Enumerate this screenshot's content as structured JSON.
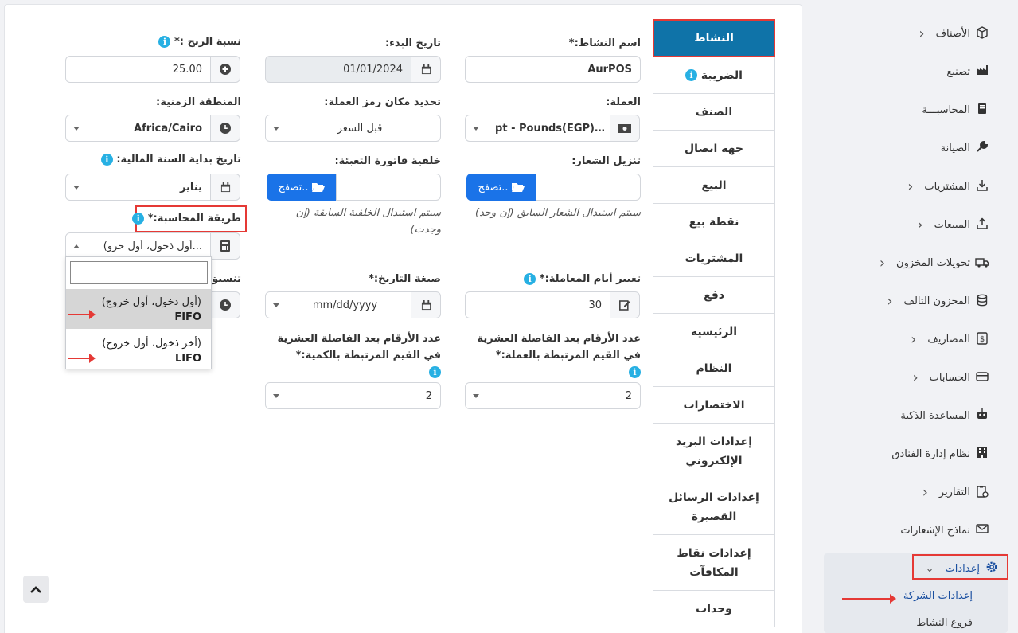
{
  "form": {
    "business_name_label": "اسم النشاط:*",
    "business_name_value": "AurPOS",
    "start_date_label": "تاريخ البدء:",
    "start_date_value": "01/01/2024",
    "profit_label": "نسبة الربح :*",
    "profit_value": "25.00",
    "currency_label": "العملة:",
    "currency_value": "pt - Pounds(EGP)",
    "currency_ellipsis": "…",
    "symbol_placement_label": "تحديد مكان رمز العملة:",
    "symbol_placement_value": "قبل السعر",
    "timezone_label": "المنطقة الزمنية:",
    "timezone_value": "Africa/Cairo",
    "logo_label": "تنزيل الشعار:",
    "logo_browse": "تصفح..",
    "logo_hint": "سيتم استبدال الشعار السابق (إن وجد)",
    "invoice_bg_label": "خلفية فاتورة التعبئة:",
    "invoice_bg_browse": "تصفح..",
    "invoice_bg_hint": "سيتم استبدال الخلفية السابقة (إن وجدت)",
    "fy_start_label": "تاريخ بداية السنة المالية:",
    "fy_start_value": "يناير",
    "accounting_method_label": "طريقة المحاسبة:*",
    "accounting_method_value": "(أول ذخول، أول خرو...",
    "transaction_days_label": "تغيير أيام المعاملة:*",
    "transaction_days_value": "30",
    "date_format_label": "صيغة التاريخ:*",
    "date_format_value": "mm/dd/yyyy",
    "time_format_label": "تنسيق",
    "currency_decimals_label": "عدد الأرقام بعد الفاصلة العشرية في القيم المرتبطة بالعملة:*",
    "currency_decimals_value": "2",
    "qty_decimals_label": "عدد الأرقام بعد الفاصلة العشرية في القيم المرتبطة بالكمية:*",
    "qty_decimals_value": "2",
    "info_glyph": "i"
  },
  "dropdown": {
    "options": [
      {
        "line1": "(أول ذخول، أول خروج)",
        "line2": "FIFO"
      },
      {
        "line1": "(أخر ذخول، أول خروج)",
        "line2": "LIFO"
      }
    ]
  },
  "tabs": [
    "النشاط",
    "الضريبة",
    "الصنف",
    "جهة اتصال",
    "البيع",
    "نقطة بيع",
    "المشتريات",
    "دفع",
    "الرئيسية",
    "النظام",
    "الاختصارات",
    "إعدادات البريد الإلكتروني",
    "إعدادات الرسائل القصيرة",
    "إعدادات نقاط المكافآت",
    "وحدات"
  ],
  "sidebar": {
    "items": [
      {
        "label": "الأصناف",
        "icon": "box-icon",
        "chevron": true
      },
      {
        "label": "تصنيع",
        "icon": "factory-icon",
        "chevron": false
      },
      {
        "label": "المحاسبـــة",
        "icon": "book-icon",
        "chevron": false
      },
      {
        "label": "الصيانة",
        "icon": "wrench-icon",
        "chevron": false
      },
      {
        "label": "المشتريات",
        "icon": "download-icon",
        "chevron": true
      },
      {
        "label": "المبيعات",
        "icon": "upload-icon",
        "chevron": true
      },
      {
        "label": "تحويلات المخزون",
        "icon": "truck-icon",
        "chevron": true
      },
      {
        "label": "المخزون التالف",
        "icon": "database-icon",
        "chevron": true
      },
      {
        "label": "المصاريف",
        "icon": "dollar-icon",
        "chevron": true
      },
      {
        "label": "الحسابات",
        "icon": "card-icon",
        "chevron": true
      },
      {
        "label": "المساعدة الذكية",
        "icon": "robot-icon",
        "chevron": false
      },
      {
        "label": "نظام إدارة الفنادق",
        "icon": "building-icon",
        "chevron": false
      },
      {
        "label": "التقارير",
        "icon": "clipboard-icon",
        "chevron": true
      },
      {
        "label": "نماذج الإشعارات",
        "icon": "mail-icon",
        "chevron": false
      }
    ],
    "settings_label": "إعدادات",
    "sub_company": "إعدادات الشركة",
    "sub_branches": "فروع النشاط"
  },
  "colors": {
    "accent": "#0f73a8",
    "highlight": "#e53935",
    "browse": "#1a73e8",
    "info": "#27b0e3"
  }
}
